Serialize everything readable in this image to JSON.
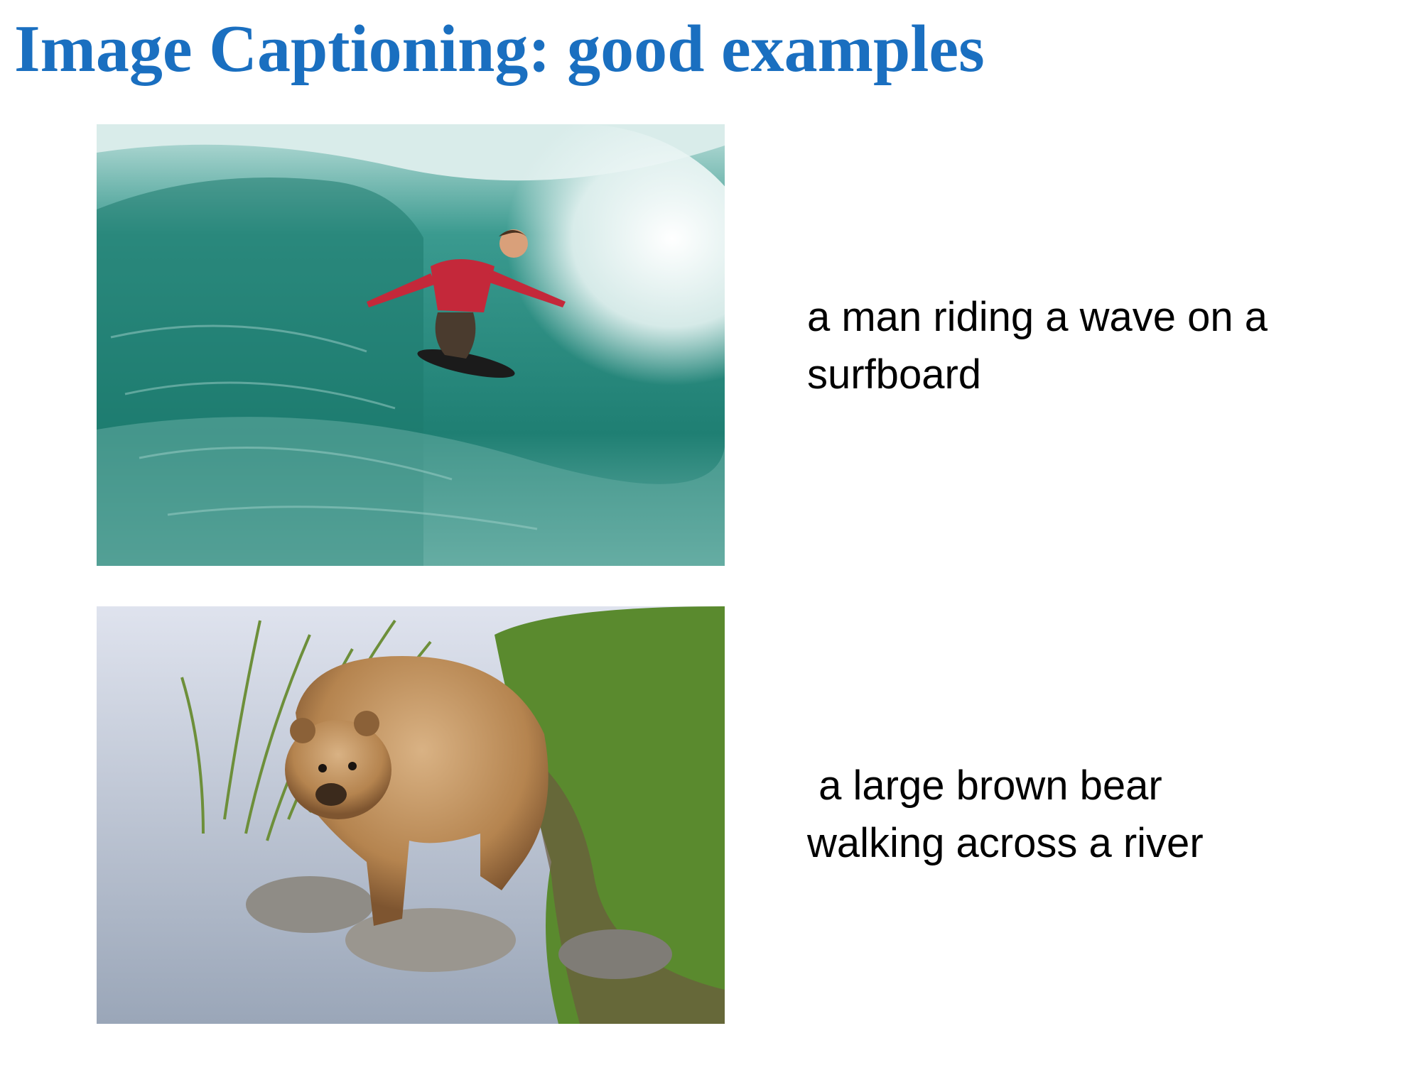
{
  "slide": {
    "title": "Image Captioning: good examples",
    "title_color": "#1a6fc0",
    "examples": [
      {
        "image_icon": "surfer-photo",
        "caption": "a man riding a wave on a\nsurfboard"
      },
      {
        "image_icon": "brown-bear-photo",
        "caption": " a large brown bear\nwalking across a river"
      }
    ]
  }
}
